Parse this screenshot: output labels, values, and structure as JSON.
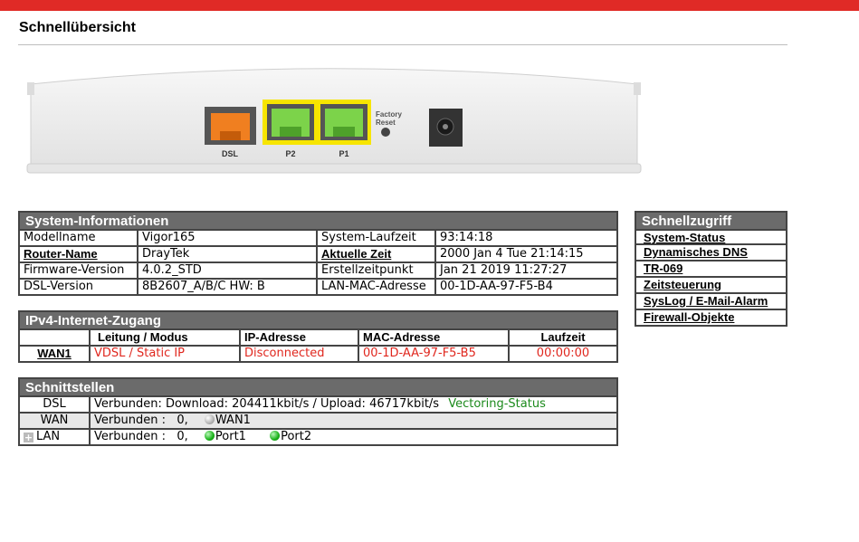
{
  "page": {
    "title": "Schnellübersicht"
  },
  "device": {
    "ports": [
      {
        "label": "DSL",
        "color": "#f07f20"
      },
      {
        "label": "P2",
        "color": "#7cd34a"
      },
      {
        "label": "P1",
        "color": "#7cd34a"
      }
    ],
    "factory_reset_line1": "Factory",
    "factory_reset_line2": "Reset"
  },
  "system_info": {
    "title": "System-Informationen",
    "rows": [
      {
        "k1": "Modellname",
        "v1": "Vigor165",
        "k2": "System-Laufzeit",
        "v2": "93:14:18"
      },
      {
        "k1": "Router-Name",
        "v1": "DrayTek",
        "k2": "Aktuelle Zeit",
        "v2": "2000 Jan 4 Tue 21:14:15"
      },
      {
        "k1": "Firmware-Version",
        "v1": "4.0.2_STD",
        "k2": "Erstellzeitpunkt",
        "v2": "Jan 21 2019 11:27:27"
      },
      {
        "k1": "DSL-Version",
        "v1": "8B2607_A/B/C HW: B",
        "k2": "LAN-MAC-Adresse",
        "v2": "00-1D-AA-97-F5-B4"
      }
    ]
  },
  "ipv4": {
    "title": "IPv4-Internet-Zugang",
    "headers": [
      "",
      "Leitung / Modus",
      "IP-Adresse",
      "MAC-Adresse",
      "Laufzeit"
    ],
    "row": {
      "name": "WAN1",
      "mode": "VDSL / Static IP",
      "ip": "Disconnected",
      "mac": "00-1D-AA-97-F5-B5",
      "uptime": "00:00:00"
    }
  },
  "interfaces": {
    "title": "Schnittstellen",
    "dsl": {
      "label": "DSL",
      "text": "Verbunden: Download: 204411kbit/s / Upload: 46717kbit/s",
      "status_link": "Vectoring-Status"
    },
    "wan": {
      "label": "WAN",
      "text": "Verbunden :   0,",
      "port": "WAN1"
    },
    "lan": {
      "label": "LAN",
      "text": "Verbunden :   0,",
      "port1": "Port1",
      "port2": "Port2"
    }
  },
  "quick_access": {
    "title": "Schnellzugriff",
    "items": [
      "System-Status",
      "Dynamisches DNS",
      "TR-069",
      "Zeitsteuerung",
      "SysLog / E-Mail-Alarm",
      "Firewall-Objekte"
    ]
  },
  "colors": {
    "top_bar": "#e02a26",
    "panel_header": "#6b6b6b",
    "alert": "#e0271e",
    "ok": "#1c8a1c"
  }
}
